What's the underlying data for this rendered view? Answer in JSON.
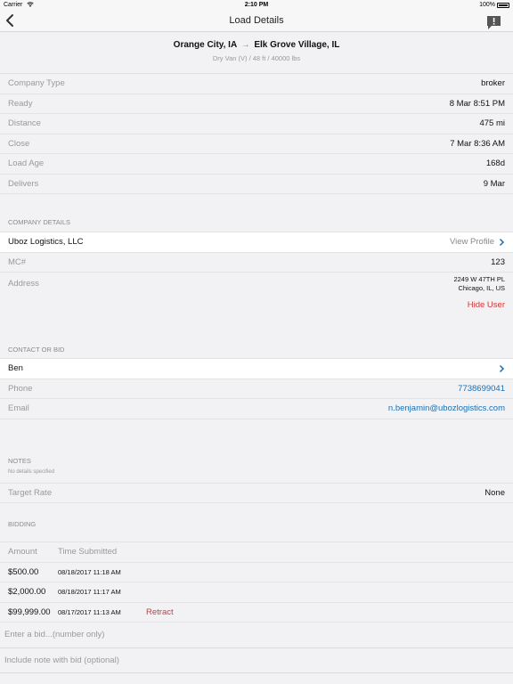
{
  "status_bar": {
    "carrier": "Carrier",
    "time": "2:10 PM",
    "battery": "100%"
  },
  "nav": {
    "title": "Load Details"
  },
  "route": {
    "origin": "Orange City, IA",
    "arrow": "→",
    "destination": "Elk Grove Village, IL",
    "subtitle": "Dry Van (V) / 48 ft / 40000 lbs"
  },
  "load_info": [
    {
      "label": "Company Type",
      "value": "broker"
    },
    {
      "label": "Ready",
      "value": "8 Mar 8:51 PM"
    },
    {
      "label": "Distance",
      "value": "475 mi"
    },
    {
      "label": "Close",
      "value": "7 Mar 8:36 AM"
    },
    {
      "label": "Load Age",
      "value": "168d"
    },
    {
      "label": "Delivers",
      "value": "9 Mar"
    }
  ],
  "company": {
    "section_title": "COMPANY DETAILS",
    "name": "Uboz Logistics, LLC",
    "view_profile": "View Profile",
    "mc_label": "MC#",
    "mc_value": "123",
    "address_label": "Address",
    "address_line1": "2249 W 47TH PL",
    "address_line2": "Chicago, IL, US",
    "hide_user": "Hide User"
  },
  "contact": {
    "section_title": "CONTACT OR BID",
    "name": "Ben",
    "phone_label": "Phone",
    "phone_value": "7738699041",
    "email_label": "Email",
    "email_value": "n.benjamin@ubozlogistics.com"
  },
  "notes": {
    "section_title": "NOTES",
    "detail": "No details specified",
    "target_rate_label": "Target Rate",
    "target_rate_value": "None"
  },
  "bidding": {
    "section_title": "BIDDING",
    "col_amount": "Amount",
    "col_time": "Time Submitted",
    "bids": [
      {
        "amount": "$500.00",
        "time": "08/18/2017 11:18 AM",
        "action": ""
      },
      {
        "amount": "$2,000.00",
        "time": "08/18/2017 11:17 AM",
        "action": ""
      },
      {
        "amount": "$99,999.00",
        "time": "08/17/2017 11:13 AM",
        "action": "Retract"
      }
    ],
    "bid_placeholder": "Enter a bid...(number only)",
    "note_placeholder": "Include note with bid (optional)"
  },
  "colors": {
    "link": "#1a6fb5",
    "danger": "#d0383a",
    "background": "#f2f2f4"
  }
}
